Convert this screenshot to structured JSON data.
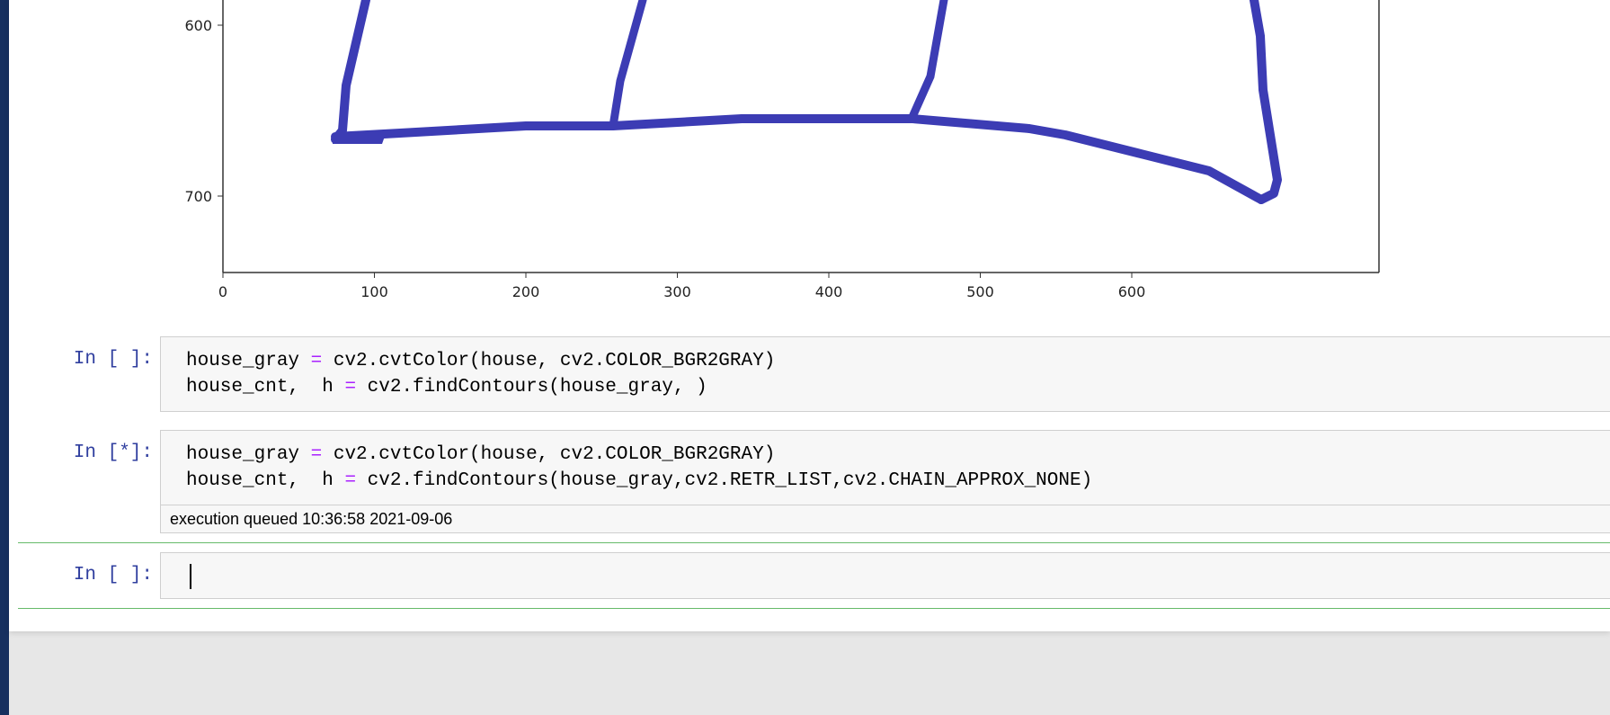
{
  "plot": {
    "x_ticks": [
      "0",
      "100",
      "200",
      "300",
      "400",
      "500",
      "600"
    ],
    "y_ticks": [
      "600",
      "700"
    ],
    "stroke_color": "#3c3cb4",
    "image": "hand-drawn house outline in blue ink"
  },
  "cells": [
    {
      "prompt": "In [ ]:",
      "lines": [
        [
          {
            "t": "house_gray ",
            "c": "plain"
          },
          {
            "t": "=",
            "c": "op"
          },
          {
            "t": " cv2.cvtColor(house, cv2.COLOR_BGR2GRAY)",
            "c": "plain"
          }
        ],
        [
          {
            "t": "house_cnt,  h ",
            "c": "plain"
          },
          {
            "t": "=",
            "c": "op"
          },
          {
            "t": " cv2.findContours(house_gray, )",
            "c": "plain"
          }
        ]
      ]
    },
    {
      "prompt": "In [*]:",
      "lines": [
        [
          {
            "t": "house_gray ",
            "c": "plain"
          },
          {
            "t": "=",
            "c": "op"
          },
          {
            "t": " cv2.cvtColor(house, cv2.COLOR_BGR2GRAY)",
            "c": "plain"
          }
        ],
        [
          {
            "t": "house_cnt,  h ",
            "c": "plain"
          },
          {
            "t": "=",
            "c": "op"
          },
          {
            "t": " cv2.findContours(house_gray,cv2.RETR_LIST,cv2.CHAIN_APPROX_NONE)",
            "c": "plain"
          }
        ]
      ],
      "status": "execution queued 10:36:58 2021-09-06"
    },
    {
      "prompt": "In [ ]:",
      "lines": []
    }
  ],
  "colors": {
    "prompt": "#303f9f",
    "operator": "#aa22ff",
    "selected_border": "#66bb6a",
    "sidebar": "#17305f"
  }
}
